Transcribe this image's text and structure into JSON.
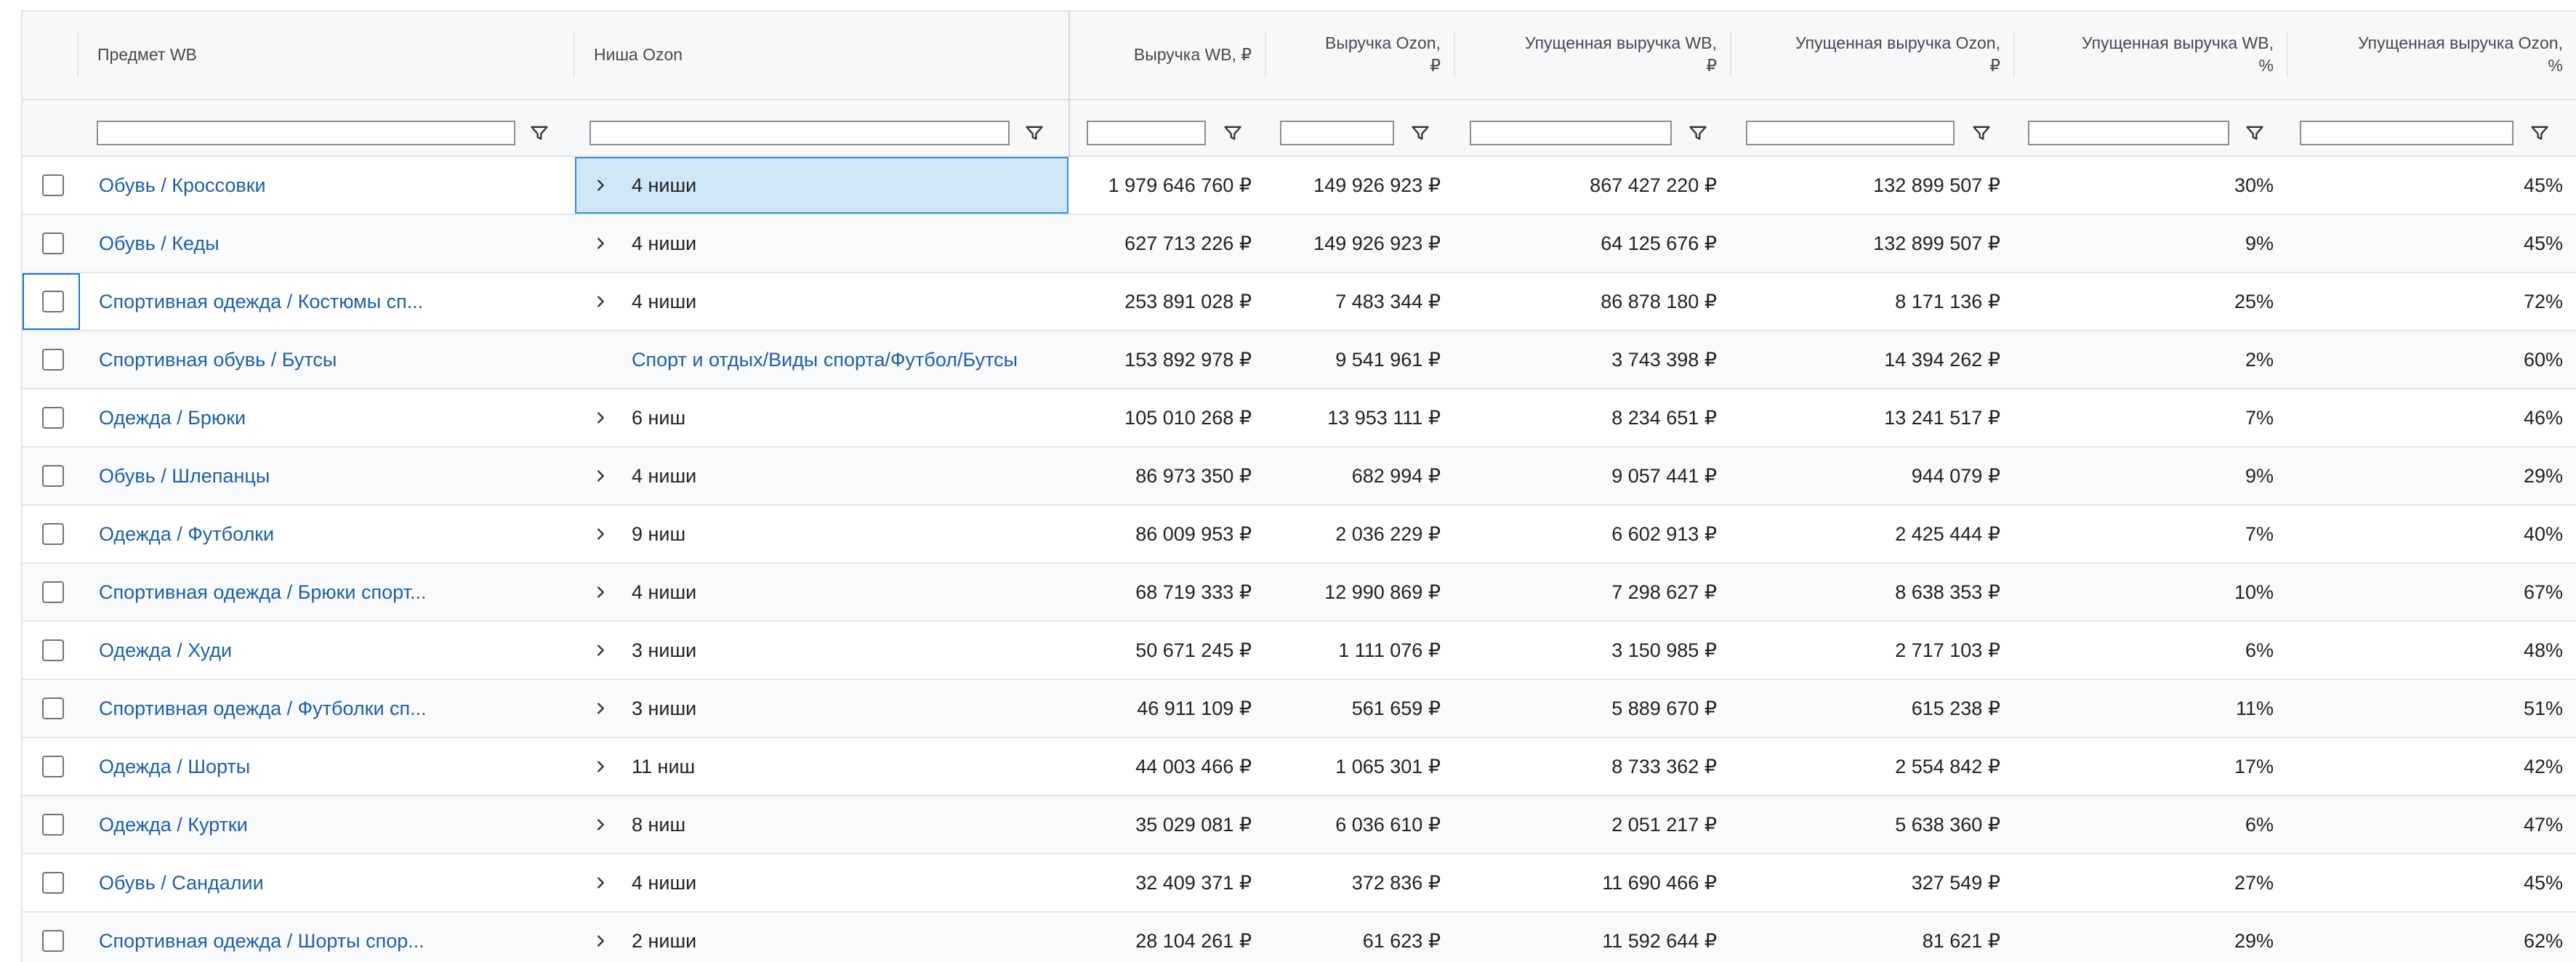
{
  "columns": {
    "subject_wb": "Предмет WB",
    "niche_ozon": "Ниша Ozon",
    "revenue_wb": "Выручка WB, ₽",
    "revenue_ozon_line1": "Выручка Ozon,",
    "revenue_ozon_line2": "₽",
    "lost_wb_line1": "Упущенная выручка WB,",
    "lost_wb_line2": "₽",
    "lost_ozon_line1": "Упущенная выручка Ozon,",
    "lost_ozon_line2": "₽",
    "lost_wb_pct_line1": "Упущенная выручка WB,",
    "lost_wb_pct_line2": "%",
    "lost_ozon_pct_line1": "Упущенная выручка Ozon,",
    "lost_ozon_pct_line2": "%"
  },
  "rows": [
    {
      "subject": "Обувь / Кроссовки",
      "niche": "4 ниши",
      "niche_link": false,
      "expandable": true,
      "rev_wb": "1 979 646 760 ₽",
      "rev_ozon": "149 926 923 ₽",
      "lost_wb": "867 427 220 ₽",
      "lost_ozon": "132 899 507 ₽",
      "lost_wb_pct": "30%",
      "lost_ozon_pct": "45%"
    },
    {
      "subject": "Обувь / Кеды",
      "niche": "4 ниши",
      "niche_link": false,
      "expandable": true,
      "rev_wb": "627 713 226 ₽",
      "rev_ozon": "149 926 923 ₽",
      "lost_wb": "64 125 676 ₽",
      "lost_ozon": "132 899 507 ₽",
      "lost_wb_pct": "9%",
      "lost_ozon_pct": "45%"
    },
    {
      "subject": "Спортивная одежда / Костюмы сп...",
      "niche": "4 ниши",
      "niche_link": false,
      "expandable": true,
      "rev_wb": "253 891 028 ₽",
      "rev_ozon": "7 483 344 ₽",
      "lost_wb": "86 878 180 ₽",
      "lost_ozon": "8 171 136 ₽",
      "lost_wb_pct": "25%",
      "lost_ozon_pct": "72%"
    },
    {
      "subject": "Спортивная обувь / Бутсы",
      "niche": "Спорт и отдых/Виды спорта/Футбол/Бутсы",
      "niche_link": true,
      "expandable": false,
      "rev_wb": "153 892 978 ₽",
      "rev_ozon": "9 541 961 ₽",
      "lost_wb": "3 743 398 ₽",
      "lost_ozon": "14 394 262 ₽",
      "lost_wb_pct": "2%",
      "lost_ozon_pct": "60%"
    },
    {
      "subject": "Одежда / Брюки",
      "niche": "6 ниш",
      "niche_link": false,
      "expandable": true,
      "rev_wb": "105 010 268 ₽",
      "rev_ozon": "13 953 111 ₽",
      "lost_wb": "8 234 651 ₽",
      "lost_ozon": "13 241 517 ₽",
      "lost_wb_pct": "7%",
      "lost_ozon_pct": "46%"
    },
    {
      "subject": "Обувь / Шлепанцы",
      "niche": "4 ниши",
      "niche_link": false,
      "expandable": true,
      "rev_wb": "86 973 350 ₽",
      "rev_ozon": "682 994 ₽",
      "lost_wb": "9 057 441 ₽",
      "lost_ozon": "944 079 ₽",
      "lost_wb_pct": "9%",
      "lost_ozon_pct": "29%"
    },
    {
      "subject": "Одежда / Футболки",
      "niche": "9 ниш",
      "niche_link": false,
      "expandable": true,
      "rev_wb": "86 009 953 ₽",
      "rev_ozon": "2 036 229 ₽",
      "lost_wb": "6 602 913 ₽",
      "lost_ozon": "2 425 444 ₽",
      "lost_wb_pct": "7%",
      "lost_ozon_pct": "40%"
    },
    {
      "subject": "Спортивная одежда / Брюки спорт...",
      "niche": "4 ниши",
      "niche_link": false,
      "expandable": true,
      "rev_wb": "68 719 333 ₽",
      "rev_ozon": "12 990 869 ₽",
      "lost_wb": "7 298 627 ₽",
      "lost_ozon": "8 638 353 ₽",
      "lost_wb_pct": "10%",
      "lost_ozon_pct": "67%"
    },
    {
      "subject": "Одежда / Худи",
      "niche": "3 ниши",
      "niche_link": false,
      "expandable": true,
      "rev_wb": "50 671 245 ₽",
      "rev_ozon": "1 111 076 ₽",
      "lost_wb": "3 150 985 ₽",
      "lost_ozon": "2 717 103 ₽",
      "lost_wb_pct": "6%",
      "lost_ozon_pct": "48%"
    },
    {
      "subject": "Спортивная одежда / Футболки сп...",
      "niche": "3 ниши",
      "niche_link": false,
      "expandable": true,
      "rev_wb": "46 911 109 ₽",
      "rev_ozon": "561 659 ₽",
      "lost_wb": "5 889 670 ₽",
      "lost_ozon": "615 238 ₽",
      "lost_wb_pct": "11%",
      "lost_ozon_pct": "51%"
    },
    {
      "subject": "Одежда / Шорты",
      "niche": "11 ниш",
      "niche_link": false,
      "expandable": true,
      "rev_wb": "44 003 466 ₽",
      "rev_ozon": "1 065 301 ₽",
      "lost_wb": "8 733 362 ₽",
      "lost_ozon": "2 554 842 ₽",
      "lost_wb_pct": "17%",
      "lost_ozon_pct": "42%"
    },
    {
      "subject": "Одежда / Куртки",
      "niche": "8 ниш",
      "niche_link": false,
      "expandable": true,
      "rev_wb": "35 029 081 ₽",
      "rev_ozon": "6 036 610 ₽",
      "lost_wb": "2 051 217 ₽",
      "lost_ozon": "5 638 360 ₽",
      "lost_wb_pct": "6%",
      "lost_ozon_pct": "47%"
    },
    {
      "subject": "Обувь / Сандалии",
      "niche": "4 ниши",
      "niche_link": false,
      "expandable": true,
      "rev_wb": "32 409 371 ₽",
      "rev_ozon": "372 836 ₽",
      "lost_wb": "11 690 466 ₽",
      "lost_ozon": "327 549 ₽",
      "lost_wb_pct": "27%",
      "lost_ozon_pct": "45%"
    },
    {
      "subject": "Спортивная одежда / Шорты спор...",
      "niche": "2 ниши",
      "niche_link": false,
      "expandable": true,
      "rev_wb": "28 104 261 ₽",
      "rev_ozon": "61 623 ₽",
      "lost_wb": "11 592 644 ₽",
      "lost_ozon": "81 621 ₽",
      "lost_wb_pct": "29%",
      "lost_ozon_pct": "62%"
    }
  ],
  "colors": {
    "link": "#1f5fa8",
    "selected_cell_bg": "#cfe7f7",
    "selected_cell_border": "#3a8dd6",
    "focus_border": "#1a73d1"
  },
  "icons": {
    "filter": "filter-funnel-icon",
    "expand": "chevron-right-icon",
    "checkbox": "checkbox-icon"
  }
}
